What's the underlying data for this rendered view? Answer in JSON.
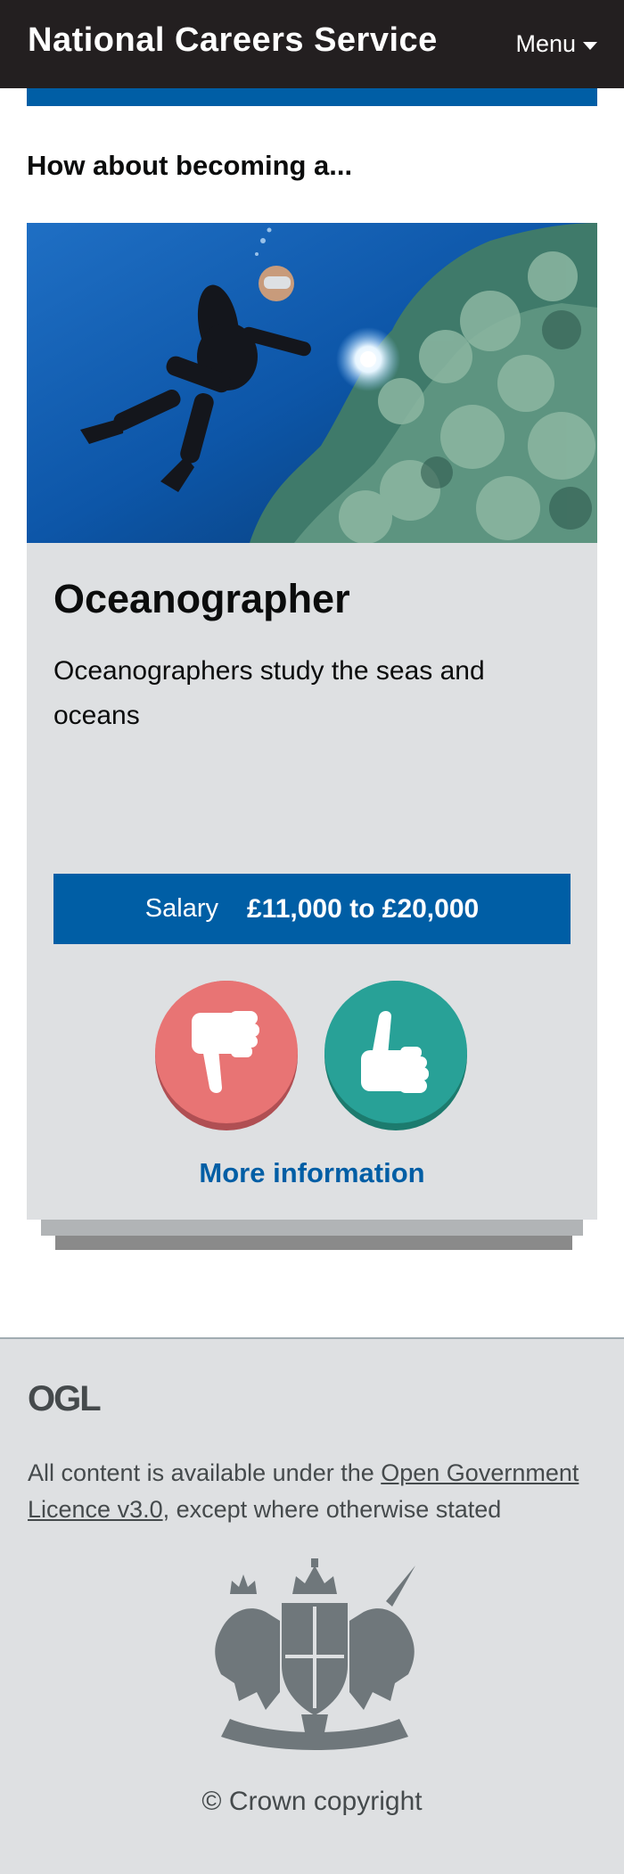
{
  "header": {
    "site_title": "National Careers Service",
    "menu_label": "Menu",
    "background": "#231f20"
  },
  "intro": {
    "heading": "How about becoming a..."
  },
  "card": {
    "image_subject": "scuba diver with torch beside coral reef",
    "title": "Oceanographer",
    "description": "Oceanographers study the seas and oceans",
    "salary_label": "Salary",
    "salary_value": "£11,000 to £20,000",
    "dislike_icon": "thumbs-down-icon",
    "like_icon": "thumbs-up-icon",
    "more_info_label": "More information",
    "colors": {
      "brand_blue": "#005ea5",
      "card_bg": "#dee0e2",
      "dislike": "#e87474",
      "like": "#28a197"
    }
  },
  "footer": {
    "ogl_logo": "OGL",
    "licence_prefix": "All content is available under the ",
    "licence_link": "Open Government Licence v3.0",
    "licence_suffix": ", except where otherwise stated",
    "crest_icon": "royal-coat-of-arms-icon",
    "copyright": "© Crown copyright"
  }
}
